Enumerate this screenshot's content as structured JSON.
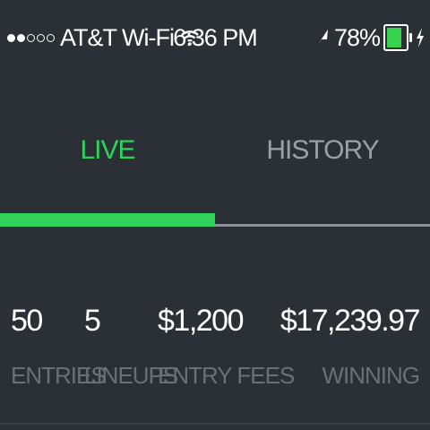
{
  "status_bar": {
    "signal_dots_filled": 2,
    "signal_dots_total": 5,
    "carrier": "AT&T Wi-Fi",
    "time": "6:36 PM",
    "battery_percent_label": "78%",
    "battery_level": 0.78,
    "icons": [
      "wifi-icon",
      "location-arrow-icon",
      "battery-icon",
      "charging-bolt-icon"
    ]
  },
  "tabs": [
    {
      "label": "LIVE",
      "active": true
    },
    {
      "label": "HISTORY",
      "active": false
    }
  ],
  "tab_indicator": {
    "active_index": 0,
    "fraction": 0.5
  },
  "stats": {
    "entries": {
      "value": "50",
      "label": "ENTRIES"
    },
    "lineups": {
      "value": "5",
      "label": "LINEUPS"
    },
    "entry_fees": {
      "value": "$1,200",
      "label": "ENTRY FEES"
    },
    "winning": {
      "value": "$17,239.97",
      "label": "WINNING"
    }
  },
  "colors": {
    "background": "#2b3036",
    "accent": "#2fd35a",
    "inactive_tab": "#9aa0a6",
    "stat_label": "#6a7077",
    "battery_fill": "#36d14d"
  }
}
